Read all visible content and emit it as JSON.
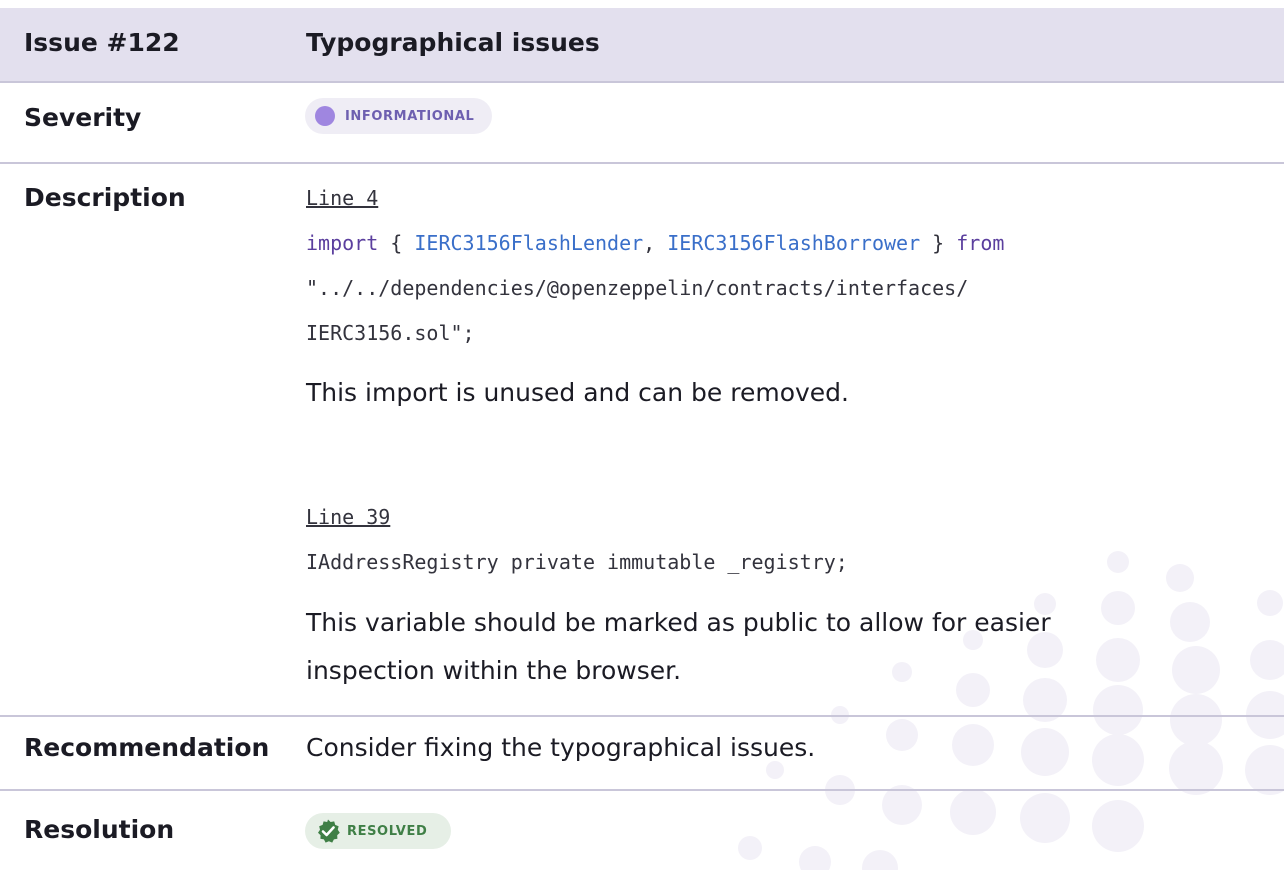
{
  "header": {
    "issue_label": "Issue #122",
    "title": "Typographical issues"
  },
  "severity": {
    "label": "Severity",
    "badge": "INFORMATIONAL",
    "badge_color": "#9f86e0"
  },
  "description": {
    "label": "Description",
    "block1": {
      "link": "Line 4",
      "code_line1": {
        "kw_import": "import",
        "brace_open": " { ",
        "name1": "IERC3156FlashLender",
        "comma": ", ",
        "name2": "IERC3156FlashBorrower",
        "brace_close": " } ",
        "kw_from": "from"
      },
      "code_line2": "\"../../dependencies/@openzeppelin/contracts/interfaces/",
      "code_line3": "IERC3156.sol\";",
      "text": "This import is unused and can be removed."
    },
    "block2": {
      "link": "Line 39",
      "code_line1": "IAddressRegistry private immutable _registry;",
      "text_line1": "This variable should be marked as public to allow for easier",
      "text_line2": "inspection within the browser."
    }
  },
  "recommendation": {
    "label": "Recommendation",
    "text": "Consider fixing the typographical issues."
  },
  "resolution": {
    "label": "Resolution",
    "badge": "RESOLVED",
    "badge_color": "#3f7f46"
  }
}
